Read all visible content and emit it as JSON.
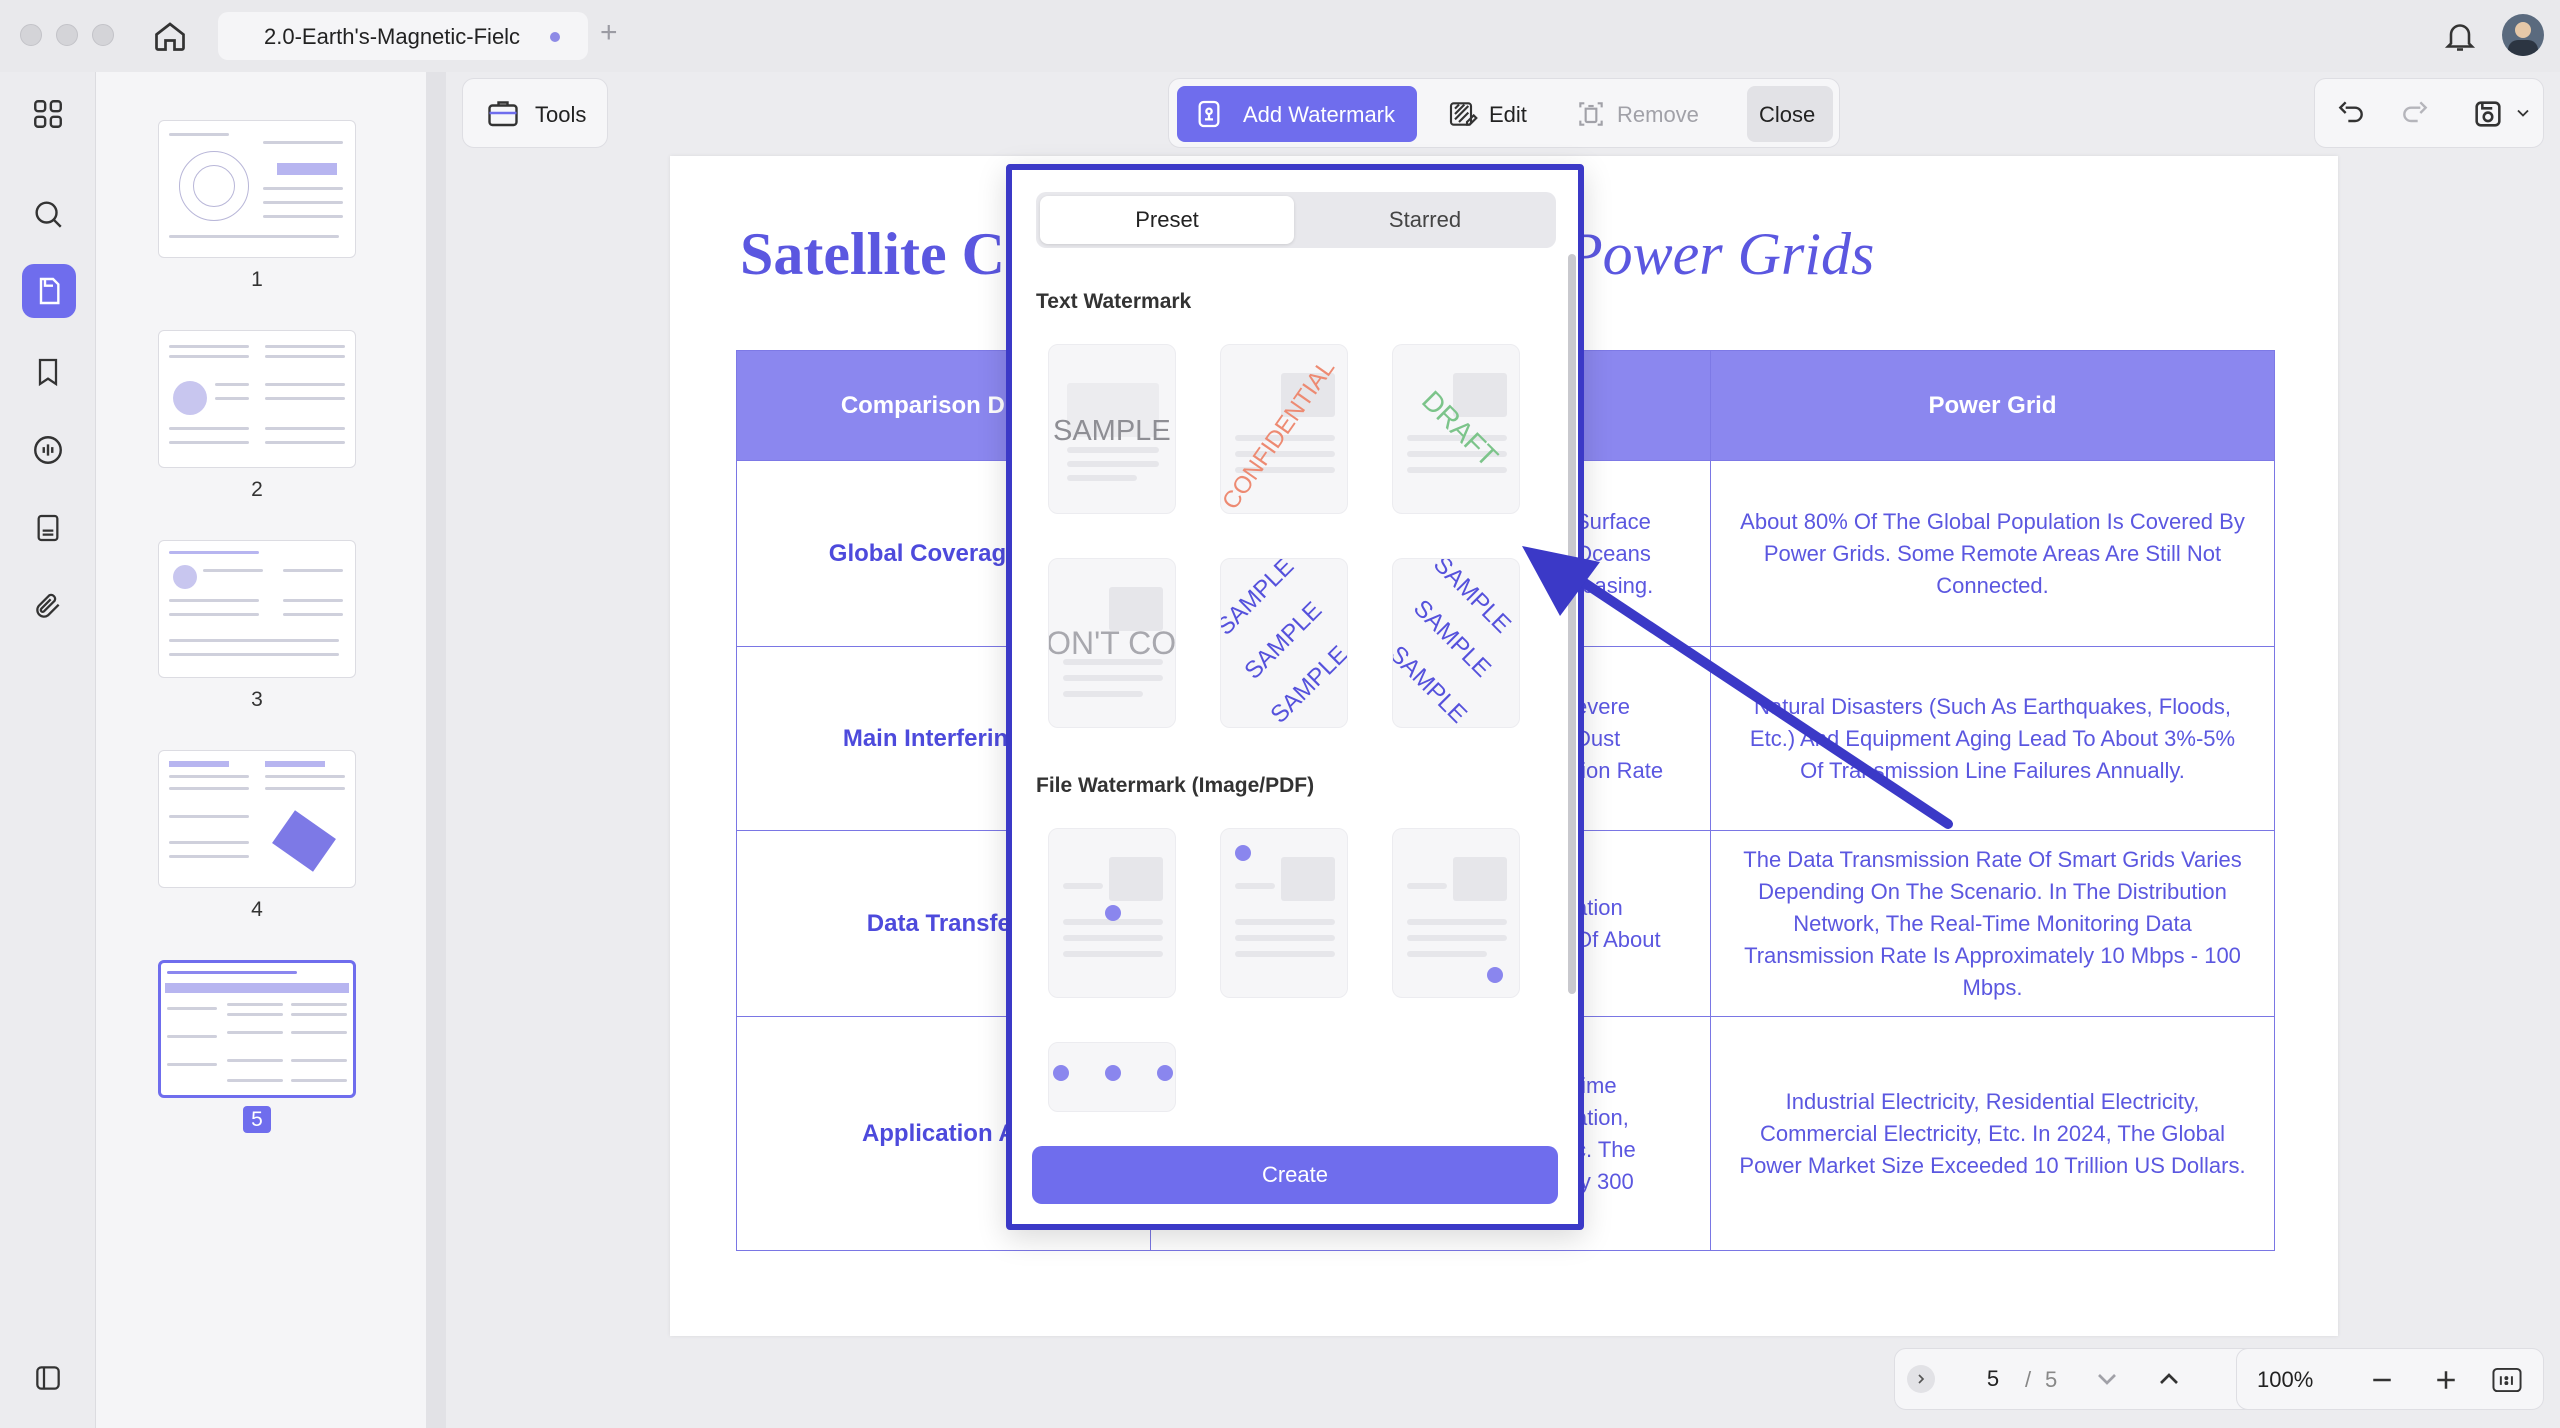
{
  "window": {
    "tab_title": "2.0-Earth's-Magnetic-Fielc"
  },
  "toolbar": {
    "tools_label": "Tools",
    "add_watermark_label": "Add Watermark",
    "edit_label": "Edit",
    "remove_label": "Remove",
    "close_label": "Close"
  },
  "thumbnails": [
    {
      "page": "1"
    },
    {
      "page": "2"
    },
    {
      "page": "3"
    },
    {
      "page": "4"
    },
    {
      "page": "5"
    }
  ],
  "document": {
    "title_left": "Satellite C",
    "title_right": "Power Grids",
    "headers": [
      "Comparison Dime",
      "",
      "Power Grid"
    ],
    "rows": [
      {
        "label": "Global Coverage(As",
        "mid": "Surface\nOceans\nreasing.",
        "grid": "About 80% Of The Global Population Is Covered By Power Grids. Some Remote Areas Are Still Not Connected."
      },
      {
        "label": "Main Interfering F",
        "mid": "evere\nDust\ntion Rate",
        "grid": "Natural Disasters (Such As Earthquakes, Floods, Etc.) And Equipment Aging Lead To About 3%-5% Of Transmission Line Failures Annually."
      },
      {
        "label": "Data Transfer",
        "mid": "ation\nOf About",
        "grid": "The Data Transmission Rate Of Smart Grids Varies Depending On The Scenario. In The Distribution Network, The Real-Time Monitoring Data Transmission Rate Is Approximately 10 Mbps - 100 Mbps."
      },
      {
        "label": "Application Ar",
        "mid": "time\nation,\nc. The\nly 300",
        "grid": "Industrial Electricity, Residential Electricity, Commercial Electricity, Etc. In 2024, The Global Power Market Size Exceeded 10 Trillion US Dollars."
      }
    ]
  },
  "watermark_panel": {
    "tab_preset": "Preset",
    "tab_starred": "Starred",
    "text_section": "Text Watermark",
    "file_section": "File Watermark (Image/PDF)",
    "presets": {
      "sample": "SAMPLE",
      "confidential": "CONFIDENTIAL",
      "draft": "DRAFT",
      "dont_copy": "DON'T COPY"
    },
    "create_label": "Create"
  },
  "pager": {
    "current": "5",
    "separator": "/",
    "total": "5"
  },
  "zoom": {
    "value": "100%"
  },
  "colors": {
    "accent": "#6f6ded",
    "doc_text": "#5b57e0",
    "highlight_border": "#3b39c7"
  }
}
